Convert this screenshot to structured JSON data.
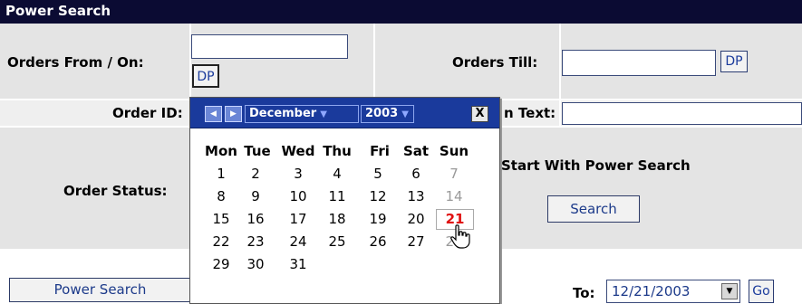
{
  "header": {
    "title": "Power Search"
  },
  "form": {
    "orders_from_label": "Orders From / On:",
    "orders_from_value": "",
    "dp_label": "DP",
    "orders_till_label": "Orders Till:",
    "orders_till_value": "",
    "order_id_label": "Order ID:",
    "search_text_label": "n Text:",
    "search_text_value": "",
    "order_status_label": "Order Status:",
    "power_search_hint": "Start With Power Search",
    "search_button": "Search"
  },
  "footer": {
    "power_search_button": "Power Search",
    "to_label": "To:",
    "to_value": "12/21/2003",
    "go_button": "Go"
  },
  "calendar": {
    "month": "December",
    "year": "2003",
    "close_label": "X",
    "weekdays": [
      "Mon",
      "Tue",
      "Wed",
      "Thu",
      "Fri",
      "Sat",
      "Sun"
    ],
    "weeks": [
      [
        "1",
        "2",
        "3",
        "4",
        "5",
        "6",
        "7"
      ],
      [
        "8",
        "9",
        "10",
        "11",
        "12",
        "13",
        "14"
      ],
      [
        "15",
        "16",
        "17",
        "18",
        "19",
        "20",
        "21"
      ],
      [
        "22",
        "23",
        "24",
        "25",
        "26",
        "27",
        "28"
      ],
      [
        "29",
        "30",
        "31",
        "",
        "",
        "",
        ""
      ]
    ],
    "selected_day": "21"
  },
  "colors": {
    "header_bg": "#0b0b33",
    "calendar_header": "#1a3a9c",
    "today_color": "#e01010"
  }
}
